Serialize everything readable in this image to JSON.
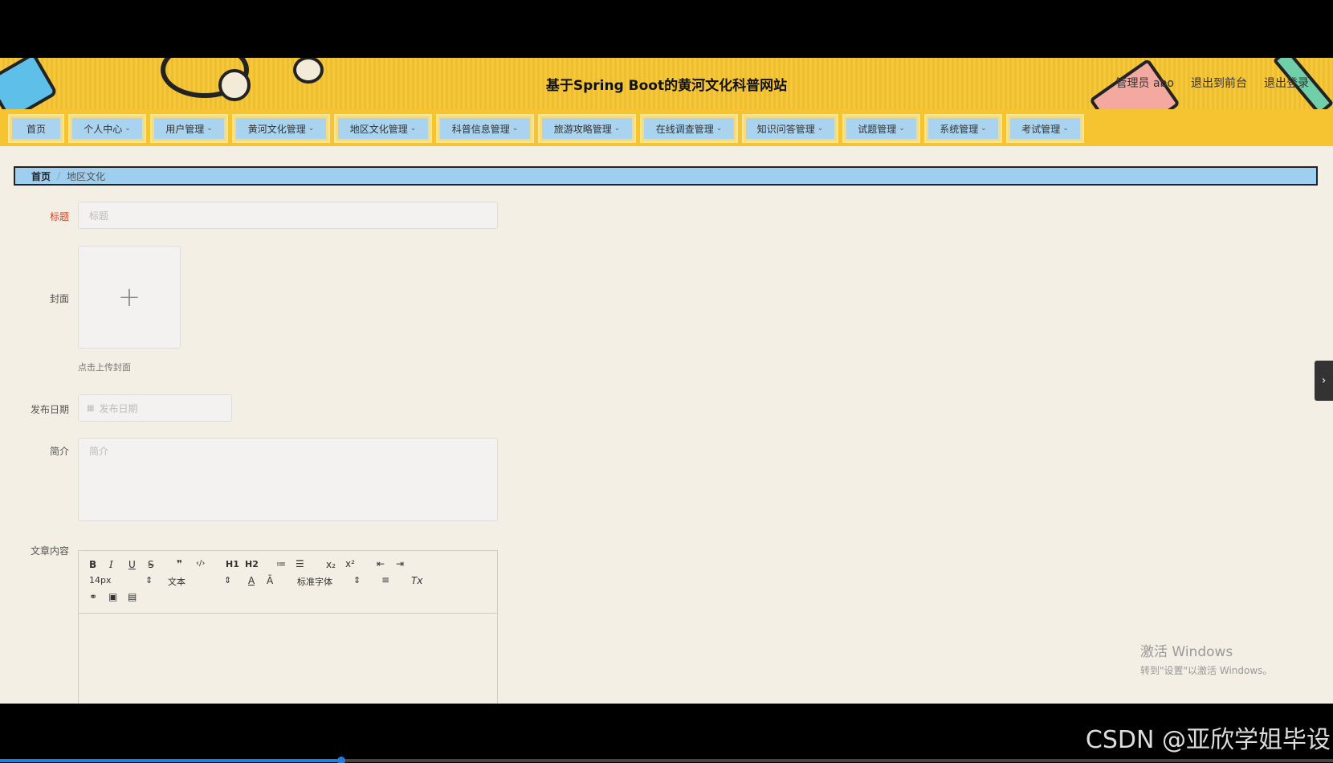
{
  "header": {
    "title": "基于Spring Boot的黄河文化科普网站",
    "user_label": "管理员 abo",
    "back_to_front": "退出到前台",
    "logout": "退出登录"
  },
  "nav": [
    {
      "label": "首页",
      "dropdown": false
    },
    {
      "label": "个人中心",
      "dropdown": true
    },
    {
      "label": "用户管理",
      "dropdown": true
    },
    {
      "label": "黄河文化管理",
      "dropdown": true
    },
    {
      "label": "地区文化管理",
      "dropdown": true
    },
    {
      "label": "科普信息管理",
      "dropdown": true
    },
    {
      "label": "旅游攻略管理",
      "dropdown": true
    },
    {
      "label": "在线调查管理",
      "dropdown": true
    },
    {
      "label": "知识问答管理",
      "dropdown": true
    },
    {
      "label": "试题管理",
      "dropdown": true
    },
    {
      "label": "系统管理",
      "dropdown": true
    },
    {
      "label": "考试管理",
      "dropdown": true
    }
  ],
  "breadcrumb": {
    "home": "首页",
    "separator": "/",
    "current": "地区文化"
  },
  "form": {
    "title_label": "标题",
    "title_placeholder": "标题",
    "cover_label": "封面",
    "cover_plus": "+",
    "cover_hint": "点击上传封面",
    "date_label": "发布日期",
    "date_placeholder": "发布日期",
    "intro_label": "简介",
    "intro_placeholder": "简介",
    "content_label": "文章内容"
  },
  "editor": {
    "bold": "B",
    "italic": "I",
    "underline": "U",
    "strike": "S",
    "quote": "❞",
    "code": "‹/›",
    "h1": "H1",
    "h2": "H2",
    "ol": "≔",
    "ul": "☰",
    "sub": "x₂",
    "sup": "x²",
    "outdent": "⇤",
    "indent": "⇥",
    "size_value": "14px",
    "header_value": "文本",
    "color": "A",
    "bg": "Ā",
    "font_value": "标准字体",
    "align": "≡",
    "clean": "Tx",
    "link": "⚭",
    "image": "▣",
    "video": "▤"
  },
  "watermark": {
    "line1": "激活 Windows",
    "line2": "转到\"设置\"以激活 Windows。"
  },
  "overlay": {
    "csdn": "CSDN @亚欣学姐毕设"
  },
  "video": {
    "progress": 0.256
  },
  "colors": {
    "header_bg": "#f5c430",
    "nav_item": "#a9d3ee",
    "breadcrumb_bg": "#9fcff0",
    "page_bg": "#f3efe4",
    "required_label": "#d42",
    "progress": "#1e7fe0"
  }
}
